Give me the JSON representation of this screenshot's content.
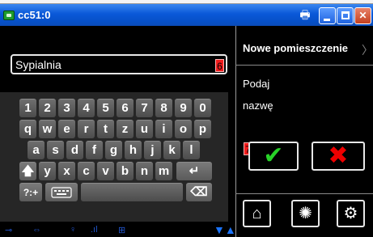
{
  "window": {
    "title": "cc51:0",
    "print_icon": "🖶",
    "minimize_icon": "minimize-icon",
    "maximize_icon": "maximize-icon",
    "close_label": "✕"
  },
  "input": {
    "value": "Sypialnia",
    "marker": "6"
  },
  "keyboard": {
    "row1": [
      "1",
      "2",
      "3",
      "4",
      "5",
      "6",
      "7",
      "8",
      "9",
      "0"
    ],
    "row2": [
      "q",
      "w",
      "e",
      "r",
      "t",
      "z",
      "u",
      "i",
      "o",
      "p"
    ],
    "row3": [
      "a",
      "s",
      "d",
      "f",
      "g",
      "h",
      "j",
      "k",
      "l"
    ],
    "row4": [
      "y",
      "x",
      "c",
      "v",
      "b",
      "n",
      "m"
    ],
    "shift_label": "🡅",
    "enter_label": "↵",
    "symbols_label": "?:+",
    "keyboard_switch_icon": "keyboard-icon",
    "backspace_label": "⌫"
  },
  "statusbar": {
    "icons": [
      "plug-icon",
      "arrows-icon",
      "bulb-icon",
      "signal-icon",
      "network-icon"
    ],
    "arrow_label": "▼▲"
  },
  "panel": {
    "title": "Nowe pomieszczenie",
    "chevron": "〉",
    "prompt_line1": "Podaj",
    "prompt_line2": "nazwę",
    "marker": "7",
    "ok_label": "✔",
    "cancel_label": "✖",
    "home_label": "⌂",
    "fan_label": "✺",
    "settings_label": "⚙"
  }
}
